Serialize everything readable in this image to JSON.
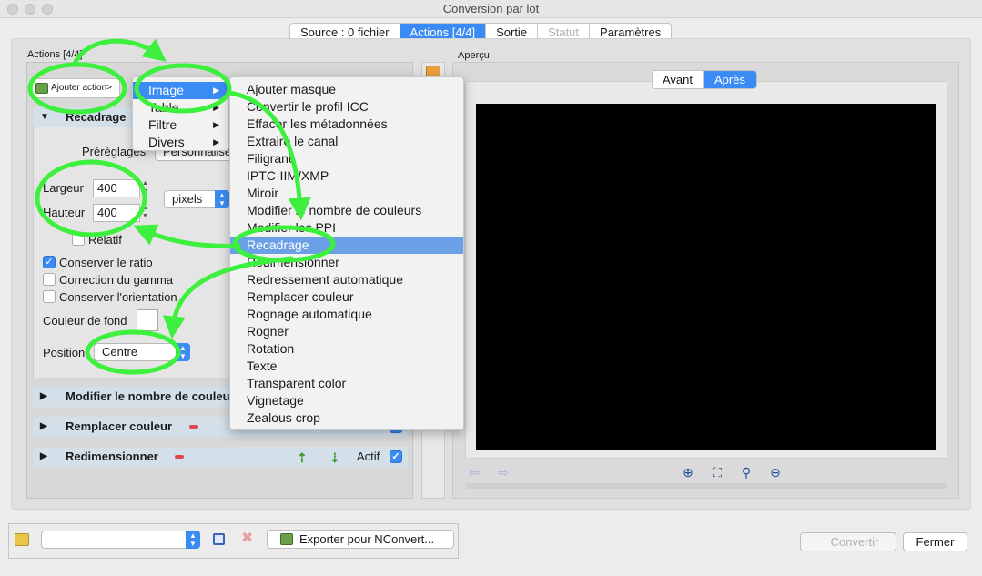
{
  "window": {
    "title": "Conversion par lot"
  },
  "tabs": [
    {
      "label": "Source : 0 fichier",
      "state": "normal"
    },
    {
      "label": "Actions [4/4]",
      "state": "active"
    },
    {
      "label": "Sortie",
      "state": "normal"
    },
    {
      "label": "Statut",
      "state": "disabled"
    },
    {
      "label": "Paramètres",
      "state": "normal"
    }
  ],
  "actions": {
    "title": "Actions [4/4]",
    "add_action_label": "Ajouter action>",
    "recadrage": {
      "title": "Recadrage",
      "preset_label": "Préréglages",
      "preset_value": "Personnalisé",
      "width_label": "Largeur",
      "width_value": "400",
      "height_label": "Hauteur",
      "height_value": "400",
      "unit_value": "pixels",
      "relative_label": "Relatif",
      "relative_checked": false,
      "keep_ratio_label": "Conserver le ratio",
      "keep_ratio_checked": true,
      "gamma_label": "Correction du gamma",
      "gamma_checked": false,
      "orientation_label": "Conserver l'orientation",
      "orientation_checked": false,
      "bg_color_label": "Couleur de fond",
      "bg_color": "#ffffff",
      "position_label": "Position",
      "position_value": "Centre"
    },
    "collapsed_sections": [
      {
        "title": "Modifier le nombre de couleurs"
      },
      {
        "title": "Remplacer couleur",
        "active_label": "Actif",
        "active_checked": true
      },
      {
        "title": "Redimensionner",
        "active_label": "Actif",
        "active_checked": true
      }
    ]
  },
  "menu_categories": [
    {
      "label": "Image",
      "selected": true
    },
    {
      "label": "Table",
      "selected": false
    },
    {
      "label": "Filtre",
      "selected": false
    },
    {
      "label": "Divers",
      "selected": false
    }
  ],
  "menu_image_items": [
    {
      "label": "Ajouter masque",
      "selected": false
    },
    {
      "label": "Convertir le profil ICC",
      "selected": false
    },
    {
      "label": "Effacer les métadonnées",
      "selected": false
    },
    {
      "label": "Extraire le canal",
      "selected": false
    },
    {
      "label": "Filigrane",
      "selected": false
    },
    {
      "label": "IPTC-IIM/XMP",
      "selected": false
    },
    {
      "label": "Miroir",
      "selected": false
    },
    {
      "label": "Modifier le nombre de couleurs",
      "selected": false
    },
    {
      "label": "Modifier les PPI",
      "selected": false
    },
    {
      "label": "Recadrage",
      "selected": true
    },
    {
      "label": "Redimensionner",
      "selected": false
    },
    {
      "label": "Redressement automatique",
      "selected": false
    },
    {
      "label": "Remplacer couleur",
      "selected": false
    },
    {
      "label": "Rognage automatique",
      "selected": false
    },
    {
      "label": "Rogner",
      "selected": false
    },
    {
      "label": "Rotation",
      "selected": false
    },
    {
      "label": "Texte",
      "selected": false
    },
    {
      "label": "Transparent color",
      "selected": false
    },
    {
      "label": "Vignetage",
      "selected": false
    },
    {
      "label": "Zealous crop",
      "selected": false
    }
  ],
  "preview": {
    "title": "Aperçu",
    "tabs": [
      {
        "label": "Avant",
        "active": false
      },
      {
        "label": "Après",
        "active": true
      }
    ],
    "canvas_color": "#000000"
  },
  "bottom": {
    "preset_select_value": "",
    "export_label": "Exporter pour NConvert...",
    "convert_label": "Convertir",
    "close_label": "Fermer"
  },
  "colors": {
    "accent": "#3b8bf5",
    "annotation": "#3df03d",
    "section_header": "#d3e0ea"
  }
}
